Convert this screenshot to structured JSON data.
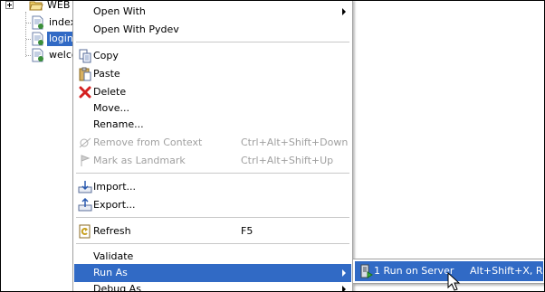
{
  "tree": {
    "items": [
      {
        "label": "WEB",
        "icon": "folder-icon",
        "expander": true,
        "selected": false
      },
      {
        "label": "index",
        "icon": "jsp-file-icon",
        "selected": false
      },
      {
        "label": "login",
        "icon": "jsp-file-icon",
        "selected": true
      },
      {
        "label": "welco",
        "icon": "jsp-file-icon",
        "selected": false
      }
    ]
  },
  "context_menu": {
    "open_with": "Open With",
    "open_with_pydev": "Open With Pydev",
    "copy": "Copy",
    "paste": "Paste",
    "delete": "Delete",
    "move": "Move...",
    "rename": "Rename...",
    "remove_from_context": "Remove from Context",
    "remove_from_context_shortcut": "Ctrl+Alt+Shift+Down",
    "mark_as_landmark": "Mark as Landmark",
    "mark_as_landmark_shortcut": "Ctrl+Alt+Shift+Up",
    "import": "Import...",
    "export": "Export...",
    "refresh": "Refresh",
    "refresh_shortcut": "F5",
    "validate": "Validate",
    "run_as": "Run As",
    "debug_as": "Debug As"
  },
  "submenu": {
    "run_on_server": "1 Run on Server",
    "run_on_server_shortcut": "Alt+Shift+X, R"
  },
  "colors": {
    "selection": "#316ac5",
    "disabled_text": "#a0a0a0",
    "delete_icon": "#d42020"
  }
}
